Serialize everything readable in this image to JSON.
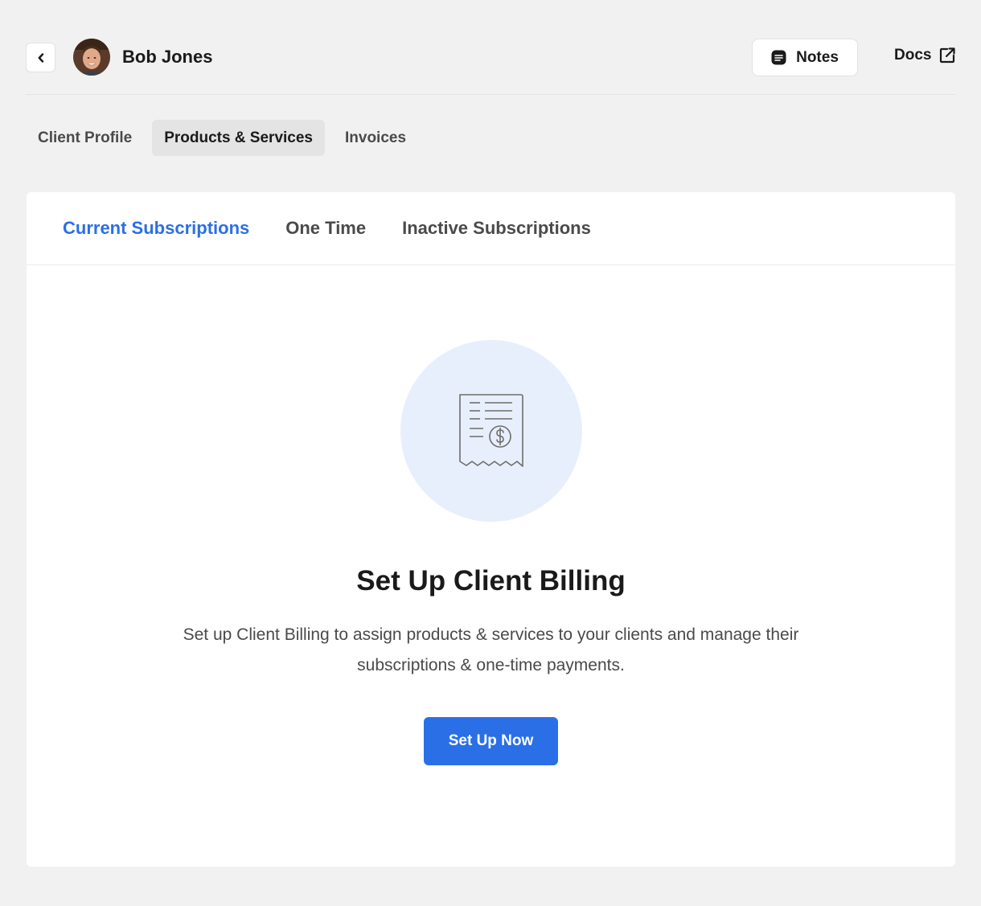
{
  "header": {
    "client_name": "Bob Jones",
    "notes_label": "Notes",
    "docs_label": "Docs"
  },
  "top_tabs": [
    {
      "label": "Client Profile",
      "active": false
    },
    {
      "label": "Products & Services",
      "active": true
    },
    {
      "label": "Invoices",
      "active": false
    }
  ],
  "sub_tabs": [
    {
      "label": "Current Subscriptions",
      "active": true
    },
    {
      "label": "One Time",
      "active": false
    },
    {
      "label": "Inactive Subscriptions",
      "active": false
    }
  ],
  "empty_state": {
    "icon": "receipt-dollar-icon",
    "title": "Set Up Client Billing",
    "description": "Set up Client Billing to assign products & services to your clients and manage their subscriptions & one-time payments.",
    "button_label": "Set Up Now"
  },
  "colors": {
    "accent": "#2a6fe6",
    "background": "#f1f1f1",
    "icon_circle": "#e8effc"
  }
}
